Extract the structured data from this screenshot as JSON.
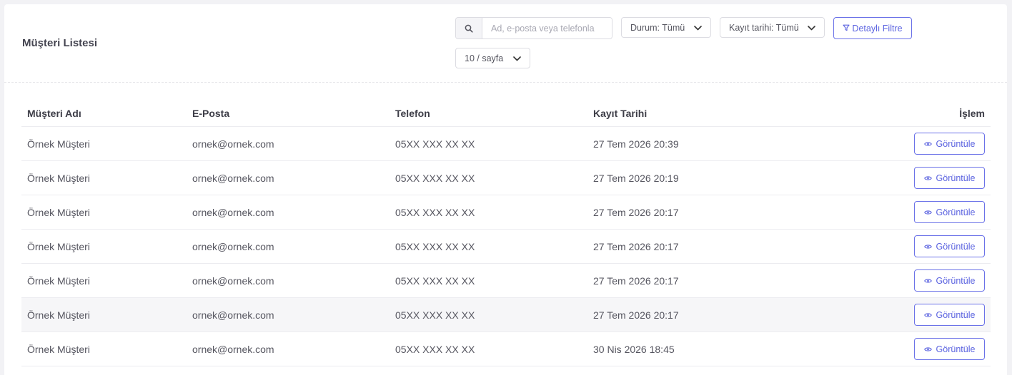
{
  "header": {
    "title": "Müşteri Listesi",
    "search_placeholder": "Ad, e-posta veya telefonla",
    "status_filter": "Durum: Tümü",
    "date_filter": "Kayıt tarihi: Tümü",
    "detail_filter_label": "Detaylı Filtre",
    "page_size": "10 / sayfa"
  },
  "table": {
    "columns": [
      "Müşteri Adı",
      "E-Posta",
      "Telefon",
      "Kayıt Tarihi",
      "İşlem"
    ],
    "action_label": "Görüntüle",
    "rows": [
      {
        "name": "Örnek Müşteri",
        "email": "ornek@ornek.com",
        "phone": "05XX XXX XX XX",
        "date": "27 Tem 2026 20:39"
      },
      {
        "name": "Örnek Müşteri",
        "email": "ornek@ornek.com",
        "phone": "05XX XXX XX XX",
        "date": "27 Tem 2026 20:19"
      },
      {
        "name": "Örnek Müşteri",
        "email": "ornek@ornek.com",
        "phone": "05XX XXX XX XX",
        "date": "27 Tem 2026 20:17"
      },
      {
        "name": "Örnek Müşteri",
        "email": "ornek@ornek.com",
        "phone": "05XX XXX XX XX",
        "date": "27 Tem 2026 20:17"
      },
      {
        "name": "Örnek Müşteri",
        "email": "ornek@ornek.com",
        "phone": "05XX XXX XX XX",
        "date": "27 Tem 2026 20:17"
      },
      {
        "name": "Örnek Müşteri",
        "email": "ornek@ornek.com",
        "phone": "05XX XXX XX XX",
        "date": "27 Tem 2026 20:17"
      },
      {
        "name": "Örnek Müşteri",
        "email": "ornek@ornek.com",
        "phone": "05XX XXX XX XX",
        "date": "30 Nis 2026 18:45"
      }
    ]
  },
  "colors": {
    "accent": "#5b63e0",
    "accent_border": "#6b72e8",
    "row_highlight": "#f6f6f8"
  },
  "icons": {
    "search": "search-icon",
    "chevron": "chevron-down-icon",
    "filter": "filter-icon",
    "view": "eye-icon"
  }
}
